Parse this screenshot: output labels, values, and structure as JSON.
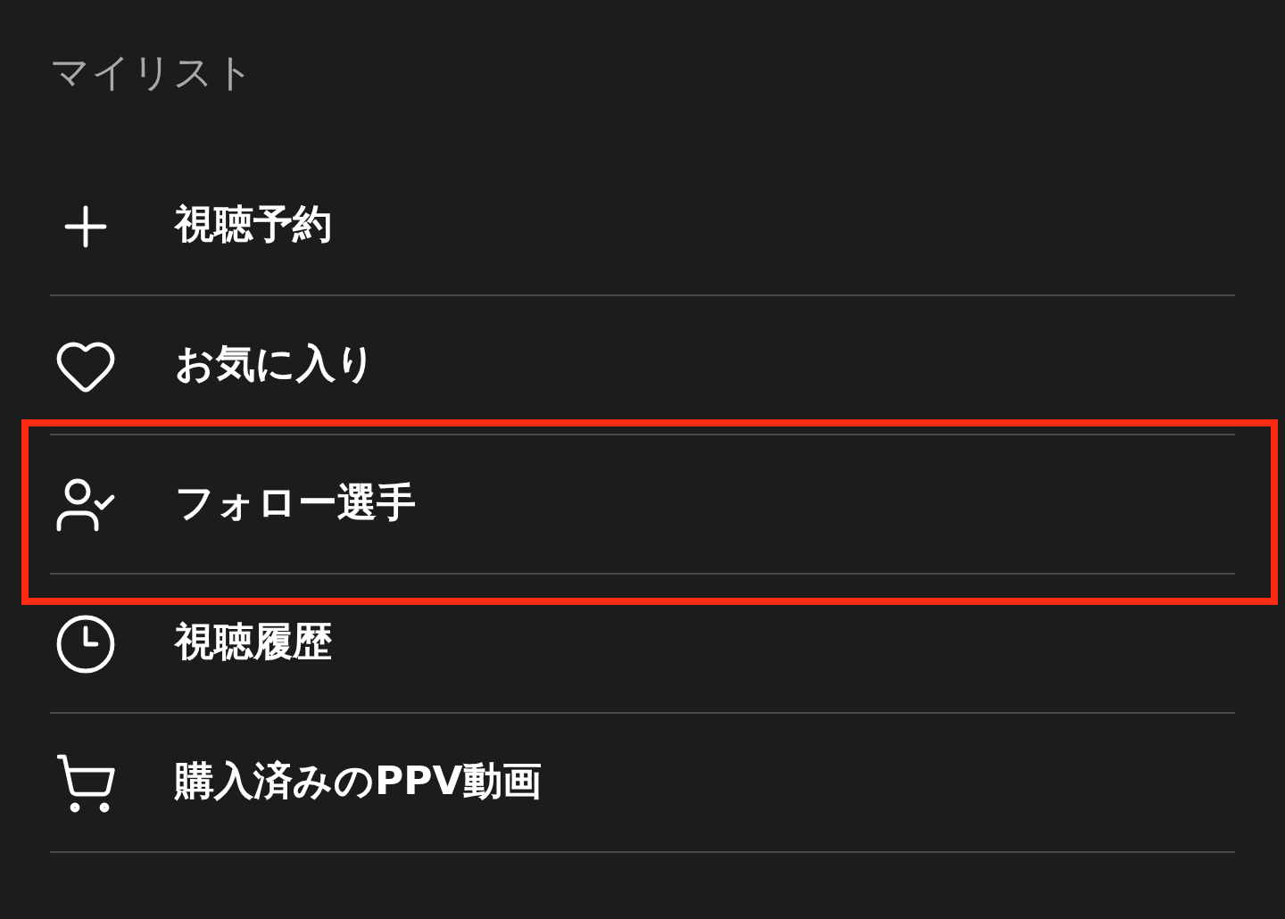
{
  "heading": "マイリスト",
  "items": [
    {
      "label": "視聴予約",
      "highlighted": false
    },
    {
      "label": "お気に入り",
      "highlighted": false
    },
    {
      "label": "フォロー選手",
      "highlighted": true
    },
    {
      "label": "視聴履歴",
      "highlighted": false
    },
    {
      "label": "購入済みのPPV動画",
      "highlighted": false
    }
  ]
}
